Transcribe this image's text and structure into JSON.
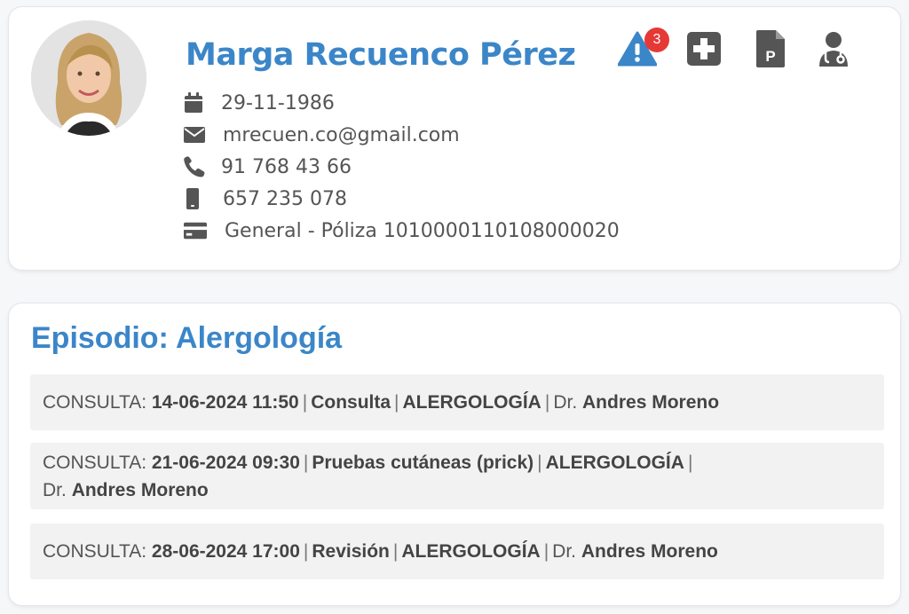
{
  "patient": {
    "name": "Marga Recuenco Pérez",
    "birthdate": "29-11-1986",
    "email": "mrecuen.co@gmail.com",
    "phone": "91 768 43 66",
    "mobile": "657 235 078",
    "insurance": "General - Póliza 1010000110108000020"
  },
  "actions": {
    "alerts_count": "3",
    "icons": [
      "alert-triangle-icon",
      "add-square-icon",
      "parking-file-icon",
      "doctor-icon"
    ]
  },
  "episode": {
    "title": "Episodio: Alergología",
    "appointments": [
      {
        "prefix": "CONSULTA:",
        "datetime": "14-06-2024 11:50",
        "type": "Consulta",
        "specialty": "ALERGOLOGÍA",
        "dr_prefix": "Dr.",
        "doctor": "Andres Moreno"
      },
      {
        "prefix": "CONSULTA:",
        "datetime": "21-06-2024 09:30",
        "type": "Pruebas cutáneas (prick)",
        "specialty": "ALERGOLOGÍA",
        "dr_prefix": "Dr.",
        "doctor": "Andres Moreno"
      },
      {
        "prefix": "CONSULTA:",
        "datetime": "28-06-2024 17:00",
        "type": "Revisión",
        "specialty": "ALERGOLOGÍA",
        "dr_prefix": "Dr.",
        "doctor": "Andres Moreno"
      }
    ]
  },
  "colors": {
    "accent": "#3b86c8",
    "badge": "#e53935",
    "icon": "#555555",
    "row_bg": "#f2f2f2"
  }
}
